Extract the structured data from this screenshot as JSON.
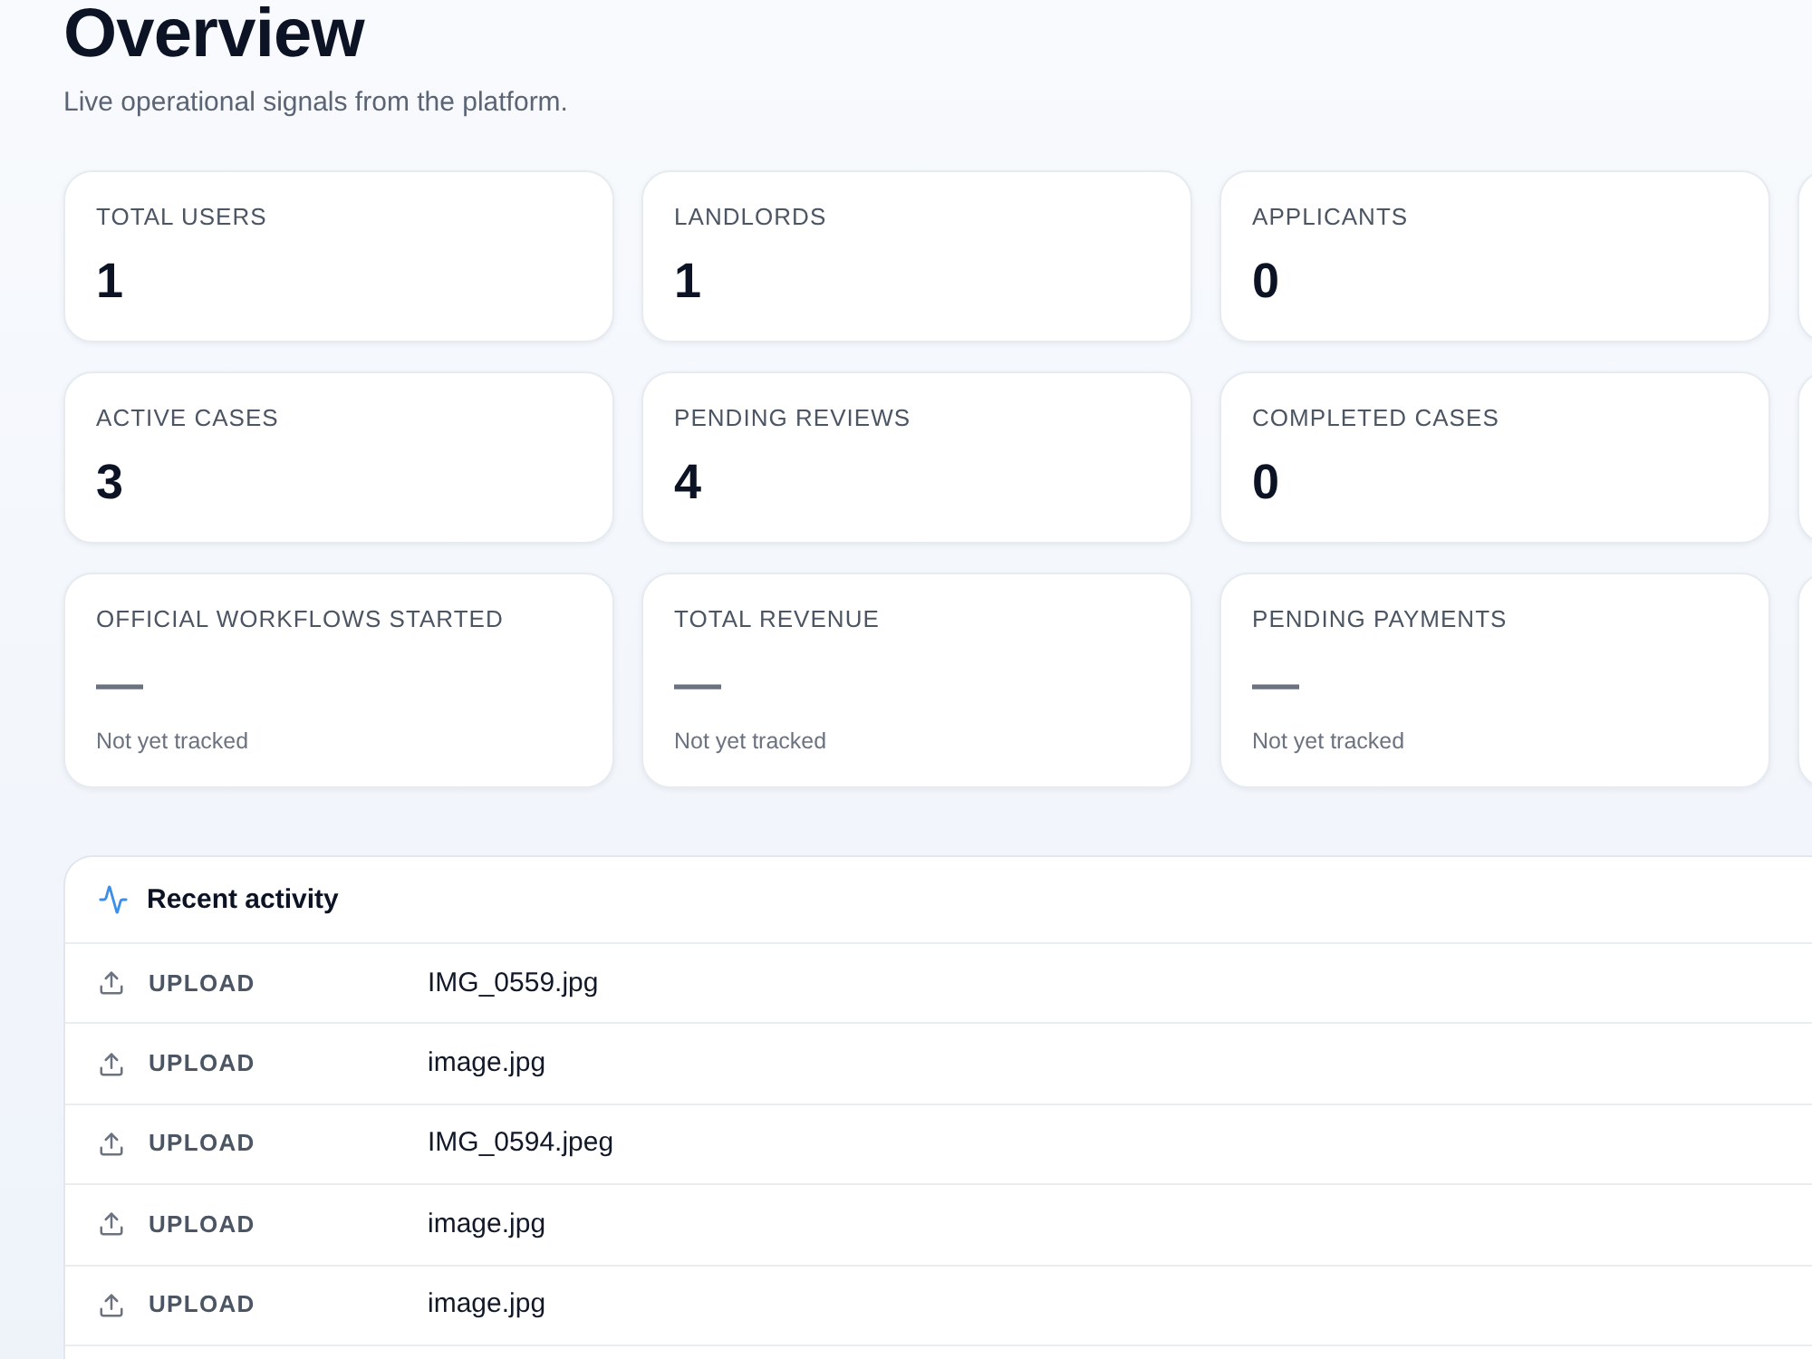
{
  "page": {
    "title": "Overview",
    "subtitle": "Live operational signals from the platform."
  },
  "stat_rows": [
    [
      {
        "kind": "count",
        "label": "TOTAL USERS",
        "value": "1"
      },
      {
        "kind": "count",
        "label": "LANDLORDS",
        "value": "1"
      },
      {
        "kind": "count",
        "label": "APPLICANTS",
        "value": "0"
      }
    ],
    [
      {
        "kind": "count",
        "label": "ACTIVE CASES",
        "value": "3"
      },
      {
        "kind": "count",
        "label": "PENDING REVIEWS",
        "value": "4"
      },
      {
        "kind": "count",
        "label": "COMPLETED CASES",
        "value": "0"
      }
    ],
    [
      {
        "kind": "untracked",
        "label": "OFFICIAL WORKFLOWS STARTED",
        "value": "—",
        "note": "Not yet tracked"
      },
      {
        "kind": "untracked",
        "label": "TOTAL REVENUE",
        "value": "—",
        "note": "Not yet tracked"
      },
      {
        "kind": "untracked",
        "label": "PENDING PAYMENTS",
        "value": "—",
        "note": "Not yet tracked"
      }
    ]
  ],
  "recent_activity": {
    "title": "Recent activity",
    "rows": [
      {
        "kind": "upload",
        "action": "UPLOAD",
        "file": "IMG_0559.jpg"
      },
      {
        "kind": "upload",
        "action": "UPLOAD",
        "file": "image.jpg"
      },
      {
        "kind": "upload",
        "action": "UPLOAD",
        "file": "IMG_0594.jpeg"
      },
      {
        "kind": "upload",
        "action": "UPLOAD",
        "file": "image.jpg"
      },
      {
        "kind": "upload",
        "action": "UPLOAD",
        "file": "image.jpg"
      }
    ]
  }
}
